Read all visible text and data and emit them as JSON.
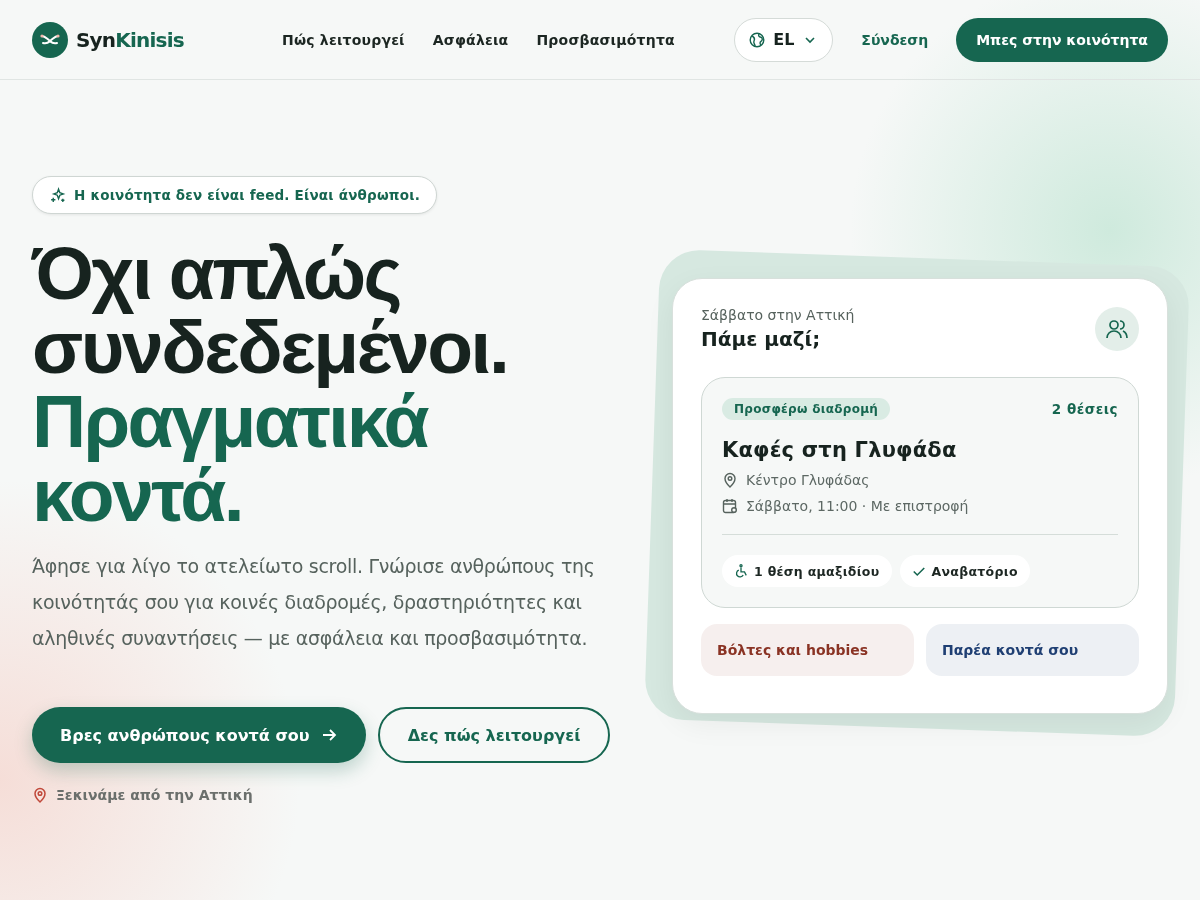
{
  "header": {
    "logo": {
      "first": "Syn",
      "second": "Kinisis"
    },
    "nav": [
      "Πώς λειτουργεί",
      "Ασφάλεια",
      "Προσβασιμότητα"
    ],
    "language": "EL",
    "login": "Σύνδεση",
    "cta": "Μπες στην κοινότητα"
  },
  "hero": {
    "badge": "Η κοινότητα δεν είναι feed. Είναι άνθρωποι.",
    "headline": [
      {
        "text": "Όχι απλώς",
        "kind": "dark"
      },
      {
        "text": "συνδεδεμένοι.",
        "kind": "dark"
      },
      {
        "text": "Πραγματικά",
        "kind": "accent"
      },
      {
        "text": "κοντά.",
        "kind": "accent"
      }
    ],
    "lead": "Άφησε για λίγο το ατελείωτο scroll. Γνώρισε ανθρώπους της κοινότητάς σου για κοινές διαδρομές, δραστηριότητες και αληθινές συναντήσεις — με ασφάλεια και προσβασιμότητα.",
    "primary_button": "Βρες ανθρώπους κοντά σου",
    "secondary_button": "Δες πώς λειτουργεί",
    "location_note": "Ξεκινάμε από την Αττική"
  },
  "card": {
    "subtitle": "Σάββατο στην Αττική",
    "title": "Πάμε μαζί;",
    "ride": {
      "tag": "Προσφέρω διαδρομή",
      "seats": "2 θέσεις",
      "title": "Καφές στη Γλυφάδα",
      "details": [
        {
          "kind": "place",
          "text": "Κέντρο Γλυφάδας"
        },
        {
          "kind": "time",
          "text": "Σάββατο, 11:00 · Με επιστροφή"
        }
      ],
      "features": [
        {
          "kind": "wheelchair",
          "text": "1 θέση αμαξιδίου"
        },
        {
          "kind": "check",
          "text": "Αναβατόριο"
        }
      ]
    },
    "tiles": [
      {
        "text": "Βόλτες και hobbies",
        "color": "#8a3324"
      },
      {
        "text": "Παρέα κοντά σου",
        "color": "#1f3f73"
      }
    ]
  }
}
